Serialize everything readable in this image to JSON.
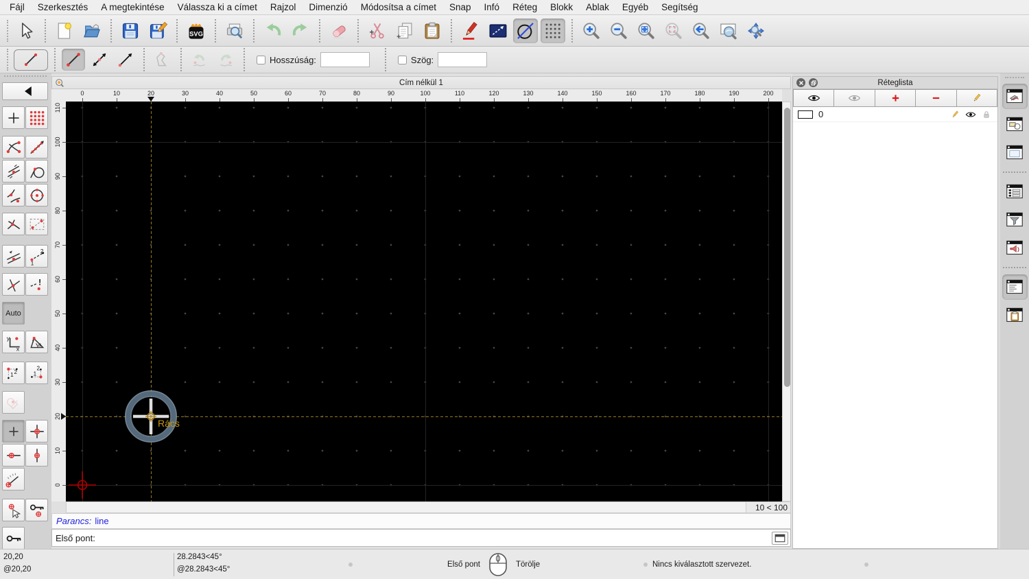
{
  "menu_bar": {
    "items": [
      {
        "id": "file",
        "label": "Fájl"
      },
      {
        "id": "edit",
        "label": "Szerkesztés"
      },
      {
        "id": "view",
        "label": "A megtekintése"
      },
      {
        "id": "select",
        "label": "Válassza ki a címet"
      },
      {
        "id": "draw",
        "label": "Rajzol"
      },
      {
        "id": "dimension",
        "label": "Dimenzió"
      },
      {
        "id": "modify",
        "label": "Módosítsa a címet"
      },
      {
        "id": "snap",
        "label": "Snap"
      },
      {
        "id": "info",
        "label": "Infó"
      },
      {
        "id": "layer",
        "label": "Réteg"
      },
      {
        "id": "block",
        "label": "Blokk"
      },
      {
        "id": "window",
        "label": "Ablak"
      },
      {
        "id": "misc",
        "label": "Egyéb"
      },
      {
        "id": "help",
        "label": "Segítség"
      }
    ]
  },
  "toolbar": {
    "groups": [
      [
        {
          "id": "select-pointer",
          "icon": "cursor"
        }
      ],
      [
        {
          "id": "new-drawing",
          "icon": "new"
        },
        {
          "id": "open-drawing",
          "icon": "open"
        }
      ],
      [
        {
          "id": "save",
          "icon": "save"
        },
        {
          "id": "save-as",
          "icon": "save-as"
        }
      ],
      [
        {
          "id": "export-svg",
          "icon": "svg"
        }
      ],
      [
        {
          "id": "print-preview",
          "icon": "print-preview"
        }
      ],
      [
        {
          "id": "undo",
          "icon": "undo"
        },
        {
          "id": "redo",
          "icon": "redo"
        }
      ],
      [
        {
          "id": "delete-selected",
          "icon": "eraser"
        }
      ],
      [
        {
          "id": "cut",
          "icon": "cut"
        },
        {
          "id": "copy",
          "icon": "copy"
        },
        {
          "id": "paste",
          "icon": "paste"
        }
      ],
      [
        {
          "id": "attributes-pen",
          "icon": "pen"
        },
        {
          "id": "selection-window",
          "icon": "sel-rect"
        },
        {
          "id": "draw-entity",
          "icon": "circle-line",
          "pressed": true
        },
        {
          "id": "grid-toggle",
          "icon": "grid",
          "pressed": true
        }
      ],
      [
        {
          "id": "zoom-in",
          "icon": "zoom-in"
        },
        {
          "id": "zoom-out",
          "icon": "zoom-out"
        },
        {
          "id": "zoom-auto",
          "icon": "zoom-auto"
        },
        {
          "id": "zoom-redraw",
          "icon": "zoom-redraw",
          "disabled": true
        },
        {
          "id": "zoom-previous",
          "icon": "zoom-previous"
        },
        {
          "id": "zoom-window",
          "icon": "zoom-window"
        },
        {
          "id": "zoom-pan",
          "icon": "zoom-pan"
        }
      ]
    ]
  },
  "tool_options": {
    "current_tool_icon": "line",
    "buttons": [
      {
        "id": "line-two-points",
        "icon": "line",
        "pressed": true
      },
      {
        "id": "line-angle",
        "icon": "line-angle"
      },
      {
        "id": "line-horizontal",
        "icon": "line-arrow"
      },
      {
        "id": "polyline",
        "icon": "polyline",
        "disabled": true
      },
      {
        "id": "undo-segment",
        "icon": "undo-seg",
        "disabled": true
      },
      {
        "id": "redo-segment",
        "icon": "redo-seg",
        "disabled": true
      }
    ],
    "length_label": "Hosszúság:",
    "length_value": "",
    "angle_label": "Szög:",
    "angle_value": ""
  },
  "snap_sidebar": {
    "auto_label": "Auto",
    "rows": [
      [
        {
          "id": "snap-free",
          "icon": "snap-free"
        },
        {
          "id": "snap-grid",
          "icon": "snap-grid"
        }
      ],
      [
        {
          "id": "snap-endpoint",
          "icon": "snap-endpoint"
        },
        {
          "id": "snap-on-entity",
          "icon": "snap-on-entity"
        }
      ],
      [
        {
          "id": "snap-middle",
          "icon": "snap-middle"
        },
        {
          "id": "snap-tangent",
          "icon": "snap-tangent"
        }
      ],
      [
        {
          "id": "snap-nearest",
          "icon": "snap-nearest"
        },
        {
          "id": "snap-center",
          "icon": "snap-center"
        }
      ],
      [
        {
          "id": "snap-intersection-auto",
          "icon": "snap-ix-auto"
        },
        {
          "id": "snap-entity",
          "icon": "snap-entity"
        }
      ],
      [
        {
          "id": "snap-parallel",
          "icon": "snap-parallel"
        },
        {
          "id": "snap-distance",
          "icon": "snap-distance"
        }
      ],
      [
        {
          "id": "snap-intersection",
          "icon": "snap-ix"
        },
        {
          "id": "snap-intersection-manual",
          "icon": "snap-ix-manual"
        }
      ],
      [
        {
          "id": "snap-auto",
          "label": "Auto",
          "pressed": true
        }
      ],
      [
        {
          "id": "coordinate-cartesian",
          "icon": "coord-xy"
        },
        {
          "id": "coordinate-polar",
          "icon": "coord-polar"
        }
      ],
      [
        {
          "id": "ordinate-first",
          "icon": "ord1"
        },
        {
          "id": "ordinate-second",
          "icon": "ord2"
        }
      ],
      [
        {
          "id": "snap-selected",
          "icon": "snap-selected",
          "faded": true
        }
      ],
      [
        {
          "id": "restrict-nothing",
          "icon": "restrict-nothing",
          "pressed": true
        },
        {
          "id": "restrict-orthogonal",
          "icon": "restrict-ortho"
        }
      ],
      [
        {
          "id": "restrict-horizontal",
          "icon": "restrict-h"
        },
        {
          "id": "restrict-vertical",
          "icon": "restrict-v"
        }
      ],
      [
        {
          "id": "angle-snap",
          "icon": "angle-snap"
        }
      ],
      [
        {
          "id": "set-relative-zero",
          "icon": "set-rel-zero"
        },
        {
          "id": "lock-relative-zero",
          "icon": "lock-rel-zero"
        }
      ],
      [
        {
          "id": "relative-zero-key",
          "icon": "key"
        }
      ]
    ]
  },
  "document": {
    "title": "Cím nélkül 1",
    "cursor_label": "Rács",
    "grid_status": "10 < 100",
    "h_ruler_labels": [
      "0",
      "10",
      "20",
      "30",
      "40",
      "50",
      "60",
      "70",
      "80",
      "90",
      "100",
      "110",
      "120",
      "130",
      "140",
      "150",
      "160",
      "170",
      "180",
      "190",
      "200"
    ],
    "v_ruler_labels": [
      "0",
      "10",
      "20",
      "30",
      "40",
      "50",
      "60",
      "70",
      "80",
      "90",
      "100",
      "110"
    ],
    "marker": {
      "x_label": "20",
      "y_label": "20"
    }
  },
  "command_dock": {
    "history_prompt": "Parancs:",
    "history_value": "line",
    "prompt_label": "Első pont:",
    "input_value": ""
  },
  "layer_panel": {
    "title": "Réteglista",
    "toolbar": [
      {
        "id": "show-all-layers",
        "icon": "eye"
      },
      {
        "id": "hide-all-layers",
        "icon": "eye-gray"
      },
      {
        "id": "add-layer",
        "icon": "plus-red"
      },
      {
        "id": "remove-layer",
        "icon": "minus-red"
      },
      {
        "id": "edit-layer",
        "icon": "pencil"
      }
    ],
    "layers": [
      {
        "name": "0",
        "visible": true,
        "locked": false
      }
    ]
  },
  "right_dock": {
    "buttons": [
      {
        "id": "layer-list-dock",
        "icon": "win-layers",
        "pressed": true
      },
      {
        "id": "block-list-dock",
        "icon": "win-blocks"
      },
      {
        "id": "library-browser-dock",
        "icon": "win-library"
      },
      {
        "id": "entity-tree-dock",
        "icon": "win-entities",
        "group_start": true
      },
      {
        "id": "filter-dock",
        "icon": "win-filter"
      },
      {
        "id": "command-widget-dock",
        "icon": "win-speaker"
      },
      {
        "id": "command-line-dock",
        "icon": "win-command",
        "pressed": true,
        "group_start": true
      },
      {
        "id": "clipboard-dock",
        "icon": "win-clipboard"
      }
    ]
  },
  "status_bar": {
    "abs_coord": "20,20",
    "rel_coord": "@20,20",
    "abs_polar": "28.2843<45°",
    "rel_polar": "@28.2843<45°",
    "left_click_hint": "Első pont",
    "right_click_hint": "Törölje",
    "selection_status": "Nincs kiválasztott szervezet."
  },
  "colors": {
    "canvas_bg": "#000000",
    "crosshair": "#96781e",
    "cursor_ring": "#54697b",
    "cursor_label": "#c8960c",
    "origin_marker": "#b00000",
    "accent_red": "#e01818",
    "command_text": "#2222dd"
  }
}
